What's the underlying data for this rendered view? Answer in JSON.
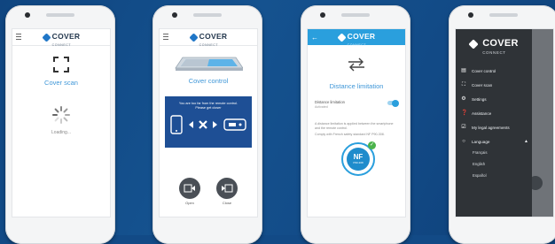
{
  "colors": {
    "background": "#124a86",
    "accent": "#3f97d8",
    "app_bar": "#2a9fdd",
    "drawer": "#2f3337",
    "bt_panel": "#1e4f95"
  },
  "brand": {
    "name": "COVER",
    "sub": "CONNECT"
  },
  "screen1": {
    "title": "Cover scan",
    "loading": "Loading...",
    "icon": "scan-frame-icon"
  },
  "screen2": {
    "title": "Cover control",
    "message_line1": "You are too far from the remote control.",
    "message_line2": "Please get closer",
    "open_label": "Open",
    "close_label": "Close"
  },
  "screen3": {
    "title": "Distance limitation",
    "setting_label": "Distance limitation",
    "setting_sub": "Activated",
    "toggle_on": true,
    "description_1": "A distance limitation is applied between the smartphone and the remote control.",
    "description_2": "Comply with French safety standard NF P90-308.",
    "badge_main": "NF",
    "badge_sub": "P90-308"
  },
  "screen4": {
    "menu": [
      {
        "label": "Cover control",
        "icon": "pool-icon"
      },
      {
        "label": "Cover scan",
        "icon": "scan-frame-icon"
      },
      {
        "label": "Settings",
        "icon": "gear-icon"
      },
      {
        "label": "Assistance",
        "icon": "help-icon"
      },
      {
        "label": "My legal agreements",
        "icon": "checkbox-icon"
      },
      {
        "label": "Language",
        "icon": "chat-icon"
      }
    ],
    "languages": [
      "Français",
      "English",
      "Español"
    ]
  }
}
